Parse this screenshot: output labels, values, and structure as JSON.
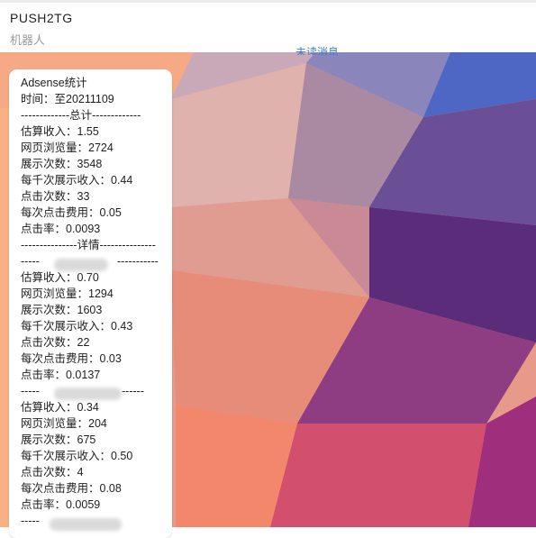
{
  "header": {
    "title": "PUSH2TG",
    "subtitle": "机器人",
    "unread_label": "未读消息"
  },
  "message": {
    "lines": [
      "Adsense统计",
      "时间：至20211109",
      "-------------总计-------------",
      "估算收入：1.55",
      "网页浏览量：2724",
      "展示次数：3548",
      "每千次展示收入：0.44",
      "点击次数：33",
      "每次点击费用：0.05",
      "点击率：0.0093",
      "---------------详情---------------",
      "-----",
      " 估算收入：0.70",
      " 网页浏览量：1294",
      " 展示次数：1603",
      " 每千次展示收入：0.43",
      " 点击次数：22",
      " 每次点击费用：0.03",
      " 点击率：0.0137",
      " -----",
      " 估算收入：0.34",
      " 网页浏览量：204",
      " 展示次数：675",
      " 每千次展示收入：0.50",
      " 点击次数：4",
      " 每次点击费用：0.08",
      " 点击率：0.0059",
      " -----"
    ],
    "detail_line_tails": [
      "-----------",
      "------"
    ]
  }
}
